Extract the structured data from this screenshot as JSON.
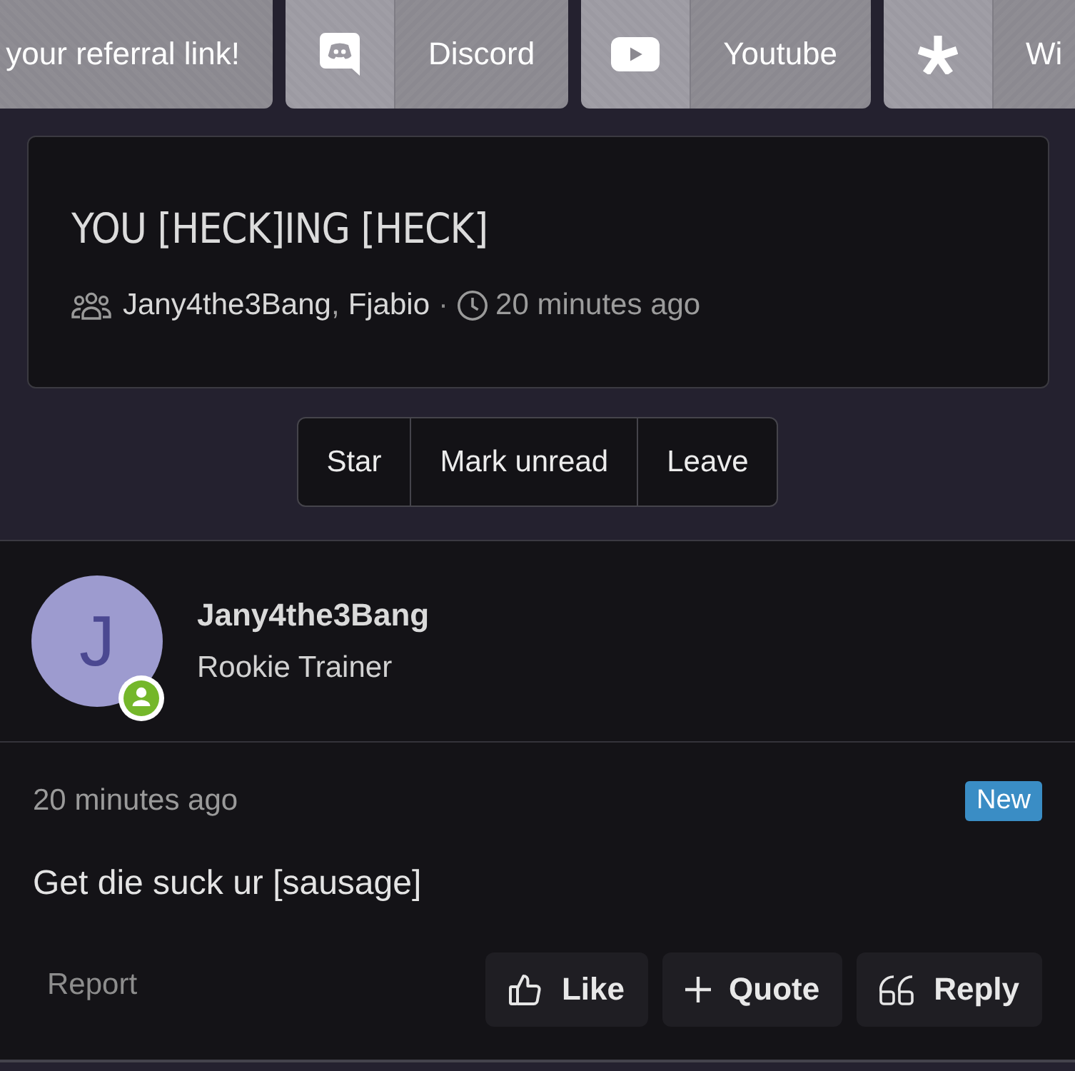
{
  "top_links": [
    {
      "kind": "text",
      "label": "your referral link!"
    },
    {
      "kind": "chat",
      "label": "Discord"
    },
    {
      "kind": "play",
      "label": "Youtube"
    },
    {
      "kind": "asterisk",
      "label": "Wi"
    }
  ],
  "thread": {
    "title": "YOU [HECK]ING [HECK]",
    "participants": [
      "Jany4the3Bang",
      "Fjabio"
    ],
    "participant_separator": ",",
    "meta_separator": "·",
    "time": "20 minutes ago"
  },
  "thread_actions": [
    "Star",
    "Mark unread",
    "Leave"
  ],
  "post": {
    "author": {
      "initial": "J",
      "online": true,
      "name": "Jany4the3Bang",
      "title": "Rookie Trainer"
    },
    "time": "20 minutes ago",
    "badge": "New",
    "message": "Get die suck ur [sausage]",
    "report": "Report",
    "actions": [
      {
        "kind": "like",
        "label": "Like"
      },
      {
        "kind": "quote",
        "label": "Quote"
      },
      {
        "kind": "reply",
        "label": "Reply"
      }
    ]
  }
}
